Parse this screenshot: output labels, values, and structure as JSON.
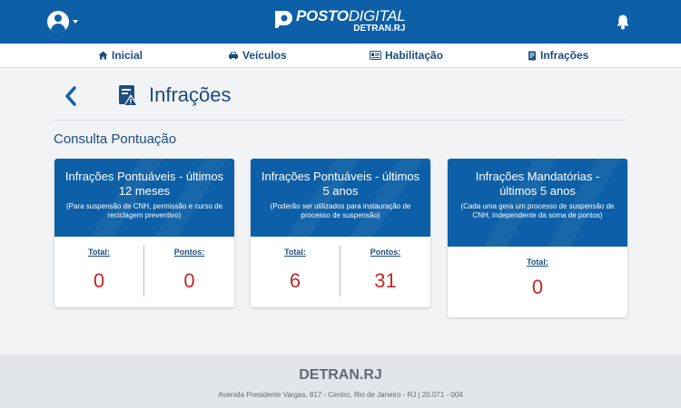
{
  "header": {
    "logo_bold": "POSTO",
    "logo_light": "DIGITAL",
    "logo_sub": "DETRAN.RJ"
  },
  "nav": [
    {
      "label": "Inicial",
      "icon": "home-icon"
    },
    {
      "label": "Veículos",
      "icon": "car-icon"
    },
    {
      "label": "Habilitação",
      "icon": "license-card-icon"
    },
    {
      "label": "Infrações",
      "icon": "infraction-icon"
    }
  ],
  "page": {
    "title": "Infrações",
    "section_title": "Consulta Pontuação"
  },
  "cards": [
    {
      "title": "Infrações Pontuáveis - últimos 12 meses",
      "desc": "(Para suspensão de CNH, permissão e curso de reciclagem preventivo)",
      "total_label": "Total:",
      "total_value": "0",
      "points_label": "Pontos:",
      "points_value": "0"
    },
    {
      "title": "Infrações Pontuáveis - últimos 5 anos",
      "desc": "(Poderão ser utilizados para instauração de processo de suspensão)",
      "total_label": "Total:",
      "total_value": "6",
      "points_label": "Pontos:",
      "points_value": "31"
    },
    {
      "title": "Infrações Mandatórias - últimos 5 anos",
      "desc": "(Cada uma gera um processo de suspensão de CNH, independente da soma de pontos)",
      "total_label": "Total:",
      "total_value": "0"
    }
  ],
  "footer": {
    "title": "DETRAN.RJ",
    "address": "Avenida Presidente Vargas, 817 - Centro, Rio de Janeiro - RJ | 20.071 - 004"
  },
  "colors": {
    "primary": "#0d5fa7",
    "text": "#1b4d7e",
    "value": "#c62828",
    "footer_bg": "#e2e5e9"
  }
}
